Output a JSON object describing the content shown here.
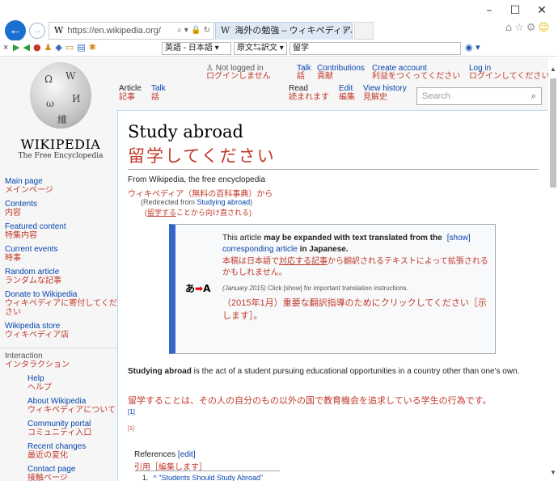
{
  "browser": {
    "url": "https://en.wikipedia.org/",
    "tab_title": "海外の勉強 – ウィキペディア、...",
    "window_controls": {
      "minimize": "–",
      "maximize": "☐",
      "close": "✕"
    },
    "toolbar": {
      "lang_pair": "英語 - 日本語",
      "mode": "原文⇆訳文",
      "translate_field": "留学"
    }
  },
  "logo": {
    "wordmark": "WIKIPEDIA",
    "tagline": "The Free Encyclopedia"
  },
  "personal": {
    "not_logged_in": {
      "en": "Not logged in",
      "jp": "ログインしません"
    },
    "talk": {
      "en": "Talk",
      "jp": "話"
    },
    "contributions": {
      "en": "Contributions",
      "jp": "貢献"
    },
    "create_account": {
      "en": "Create account",
      "jp": "利益をつくってください"
    },
    "log_in": {
      "en": "Log in",
      "jp": "ログインしてください"
    }
  },
  "tabs": {
    "article": {
      "en": "Article",
      "jp": "記事"
    },
    "talk": {
      "en": "Talk",
      "jp": "話"
    },
    "read": {
      "en": "Read",
      "jp": "読まれます"
    },
    "edit": {
      "en": "Edit",
      "jp": "編集"
    },
    "history": {
      "en": "View history",
      "jp": "見解史"
    },
    "search_placeholder": "Search"
  },
  "sidebar": {
    "items": [
      {
        "en": "Main page",
        "jp": "メインページ"
      },
      {
        "en": "Contents",
        "jp": "内容"
      },
      {
        "en": "Featured content",
        "jp": "特集内容"
      },
      {
        "en": "Current events",
        "jp": "時事"
      },
      {
        "en": "Random article",
        "jp": "ランダムな記事"
      },
      {
        "en": "Donate to Wikipedia",
        "jp": "ウィキペディアに寄付してください"
      },
      {
        "en": "Wikipedia store",
        "jp": "ウィキペディア店"
      }
    ],
    "interaction": {
      "en": "Interaction",
      "jp": "インタラクション"
    },
    "sub_items": [
      {
        "en": "Help",
        "jp": "ヘルプ"
      },
      {
        "en": "About Wikipedia",
        "jp": "ウィキペディアについて"
      },
      {
        "en": "Community portal",
        "jp": "コミュニティ入口"
      },
      {
        "en": "Recent changes",
        "jp": "最近の変化"
      },
      {
        "en": "Contact page",
        "jp": "接触ページ"
      }
    ]
  },
  "article": {
    "title_en": "Study abroad",
    "title_jp": "留学してください",
    "from_en": "From Wikipedia, the free encyclopedia",
    "from_jp": "ウィキペディア（無料の百科事典）から",
    "redirect_prefix": "(Redirected from ",
    "redirect_link": "Studying abroad",
    "redirect_suffix": ")",
    "redirect_jp_link": "留学する",
    "redirect_jp_rest": "ことから向け直される)",
    "ambox": {
      "icon_left": "あ",
      "icon_arrow": "➡",
      "icon_right": "A",
      "line1_pre": "This article ",
      "line1_bold": "may be expanded with text translated from the",
      "show": "[show]",
      "line2_link": "corresponding article",
      "line2_rest": " in Japanese.",
      "jp1_a": "本稿は日本語で",
      "jp1_link": "対応する記事",
      "jp1_b": "から翻訳されるテキストによって拡張されるかもしれません。",
      "note_date": "(January 2015)",
      "note_rest": " Click [show] for important translation instructions.",
      "jp2": "（2015年1月）重要な翻訳指導のためにクリックしてください［示します］。"
    },
    "para_bold": "Studying abroad",
    "para_rest": " is the act of a student pursuing educational opportunities in a country other than one's own.",
    "para_jp": "留学することは、その人の自分のもの以外の国で教育機会を追求している学生の行為です。",
    "cite1": "[1]",
    "cite2": "[1]",
    "refs_en": "References",
    "refs_edit": "[edit]",
    "refs_jp_a": "引用［",
    "refs_jp_link": "編集します",
    "refs_jp_b": "］",
    "ref1_num": "1.",
    "ref1_text": "^ \"Students Should Study Abroad\""
  }
}
